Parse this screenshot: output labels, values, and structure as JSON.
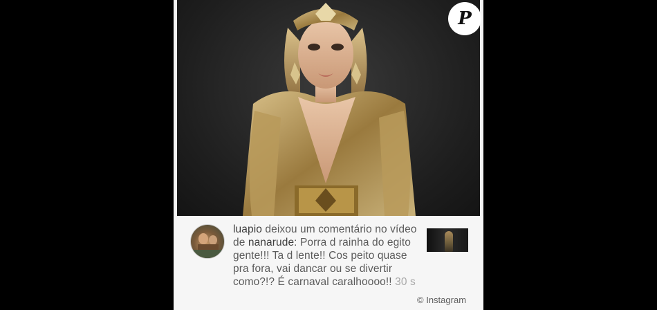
{
  "brand": {
    "logo_letter": "P",
    "logo_icon": "purepeople-logo-icon"
  },
  "photo": {
    "subject_icon": "woman-in-gold-costume-photo"
  },
  "notification": {
    "avatar_icon": "user-avatar-icon",
    "actor_username": "luapio",
    "action_text": " deixou um comentário no vídeo de ",
    "target_username": "nanarude",
    "comment_text": ": Porra d rainha do egito gente!!! Ta d lente!! Cos peito quase pra fora, vai dancar ou se divertir como?!? É carnaval caralhoooo!! ",
    "time": "30 s",
    "thumbnail_icon": "video-thumbnail-icon"
  },
  "watermark": {
    "symbol": "©",
    "text": "Instagram"
  }
}
